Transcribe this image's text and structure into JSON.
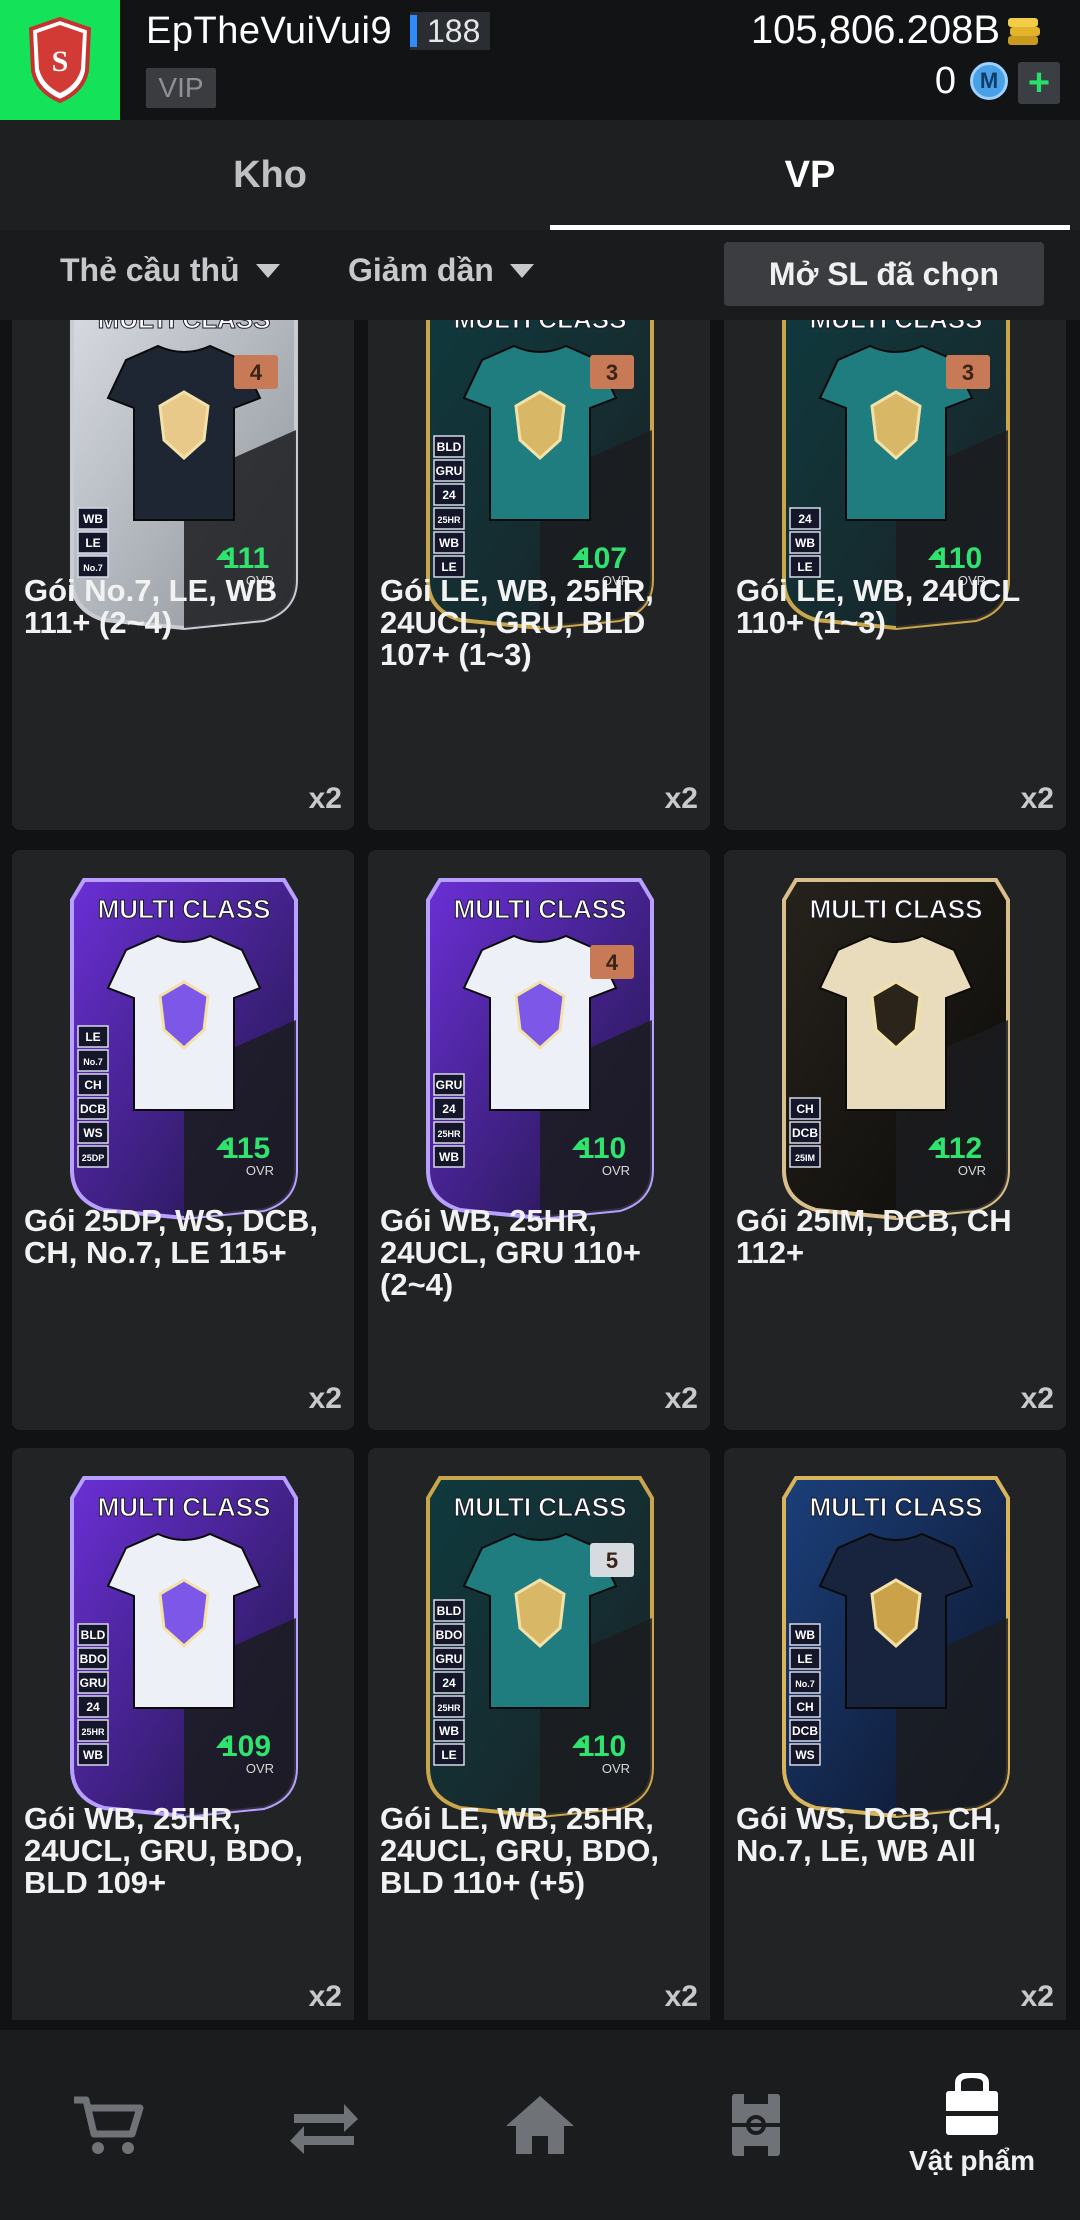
{
  "user": {
    "name": "EpTheVuiVui9",
    "level": "188",
    "vip": "VIP",
    "coins": "105,806.208B",
    "m_points": "0",
    "m_icon_label": "M",
    "plus": "+"
  },
  "tabs": [
    {
      "label": "Kho",
      "active": false
    },
    {
      "label": "VP",
      "active": true
    }
  ],
  "filters": {
    "type": "Thẻ cầu thủ",
    "sort": "Giảm dần",
    "open_selected": "Mở SL đã chọn"
  },
  "colors": {
    "accent_green": "#14e35a",
    "ovr_green": "#2fe36e",
    "level_blue": "#2f8cff"
  },
  "items": [
    {
      "title": "Gói No.7, LE, WB 111+ (2~4)",
      "qty": "x2",
      "ovr": "111",
      "ovr_label": "OVR",
      "header": "MULTI CLASS",
      "badge": "4",
      "tags": [
        "WB",
        "LE",
        "No.7"
      ],
      "theme": "silver"
    },
    {
      "title": "Gói LE, WB, 25HR,\n24UCL, GRU, BLD\n107+ (1~3)",
      "qty": "x2",
      "ovr": "107",
      "ovr_label": "OVR",
      "header": "MULTI CLASS",
      "badge": "3",
      "tags": [
        "BLD",
        "GRU",
        "24",
        "25HR",
        "WB",
        "LE"
      ],
      "theme": "teal"
    },
    {
      "title": "Gói LE, WB, 24UCL\n110+ (1~3)",
      "qty": "x2",
      "ovr": "110",
      "ovr_label": "OVR",
      "header": "MULTI CLASS",
      "badge": "3",
      "tags": [
        "24",
        "WB",
        "LE"
      ],
      "theme": "teal"
    },
    {
      "title": "Gói 25DP, WS, DCB,\nCH, No.7, LE 115+",
      "qty": "x2",
      "ovr": "115",
      "ovr_label": "OVR",
      "header": "MULTI CLASS",
      "badge": "",
      "tags": [
        "LE",
        "No.7",
        "CH",
        "DCB",
        "WS",
        "25DP"
      ],
      "theme": "purple"
    },
    {
      "title": "Gói WB, 25HR,\n24UCL, GRU 110+\n(2~4)",
      "qty": "x2",
      "ovr": "110",
      "ovr_label": "OVR",
      "header": "MULTI CLASS",
      "badge": "4",
      "tags": [
        "GRU",
        "24",
        "25HR",
        "WB"
      ],
      "theme": "purple"
    },
    {
      "title": "Gói 25IM, DCB, CH\n112+",
      "qty": "x2",
      "ovr": "112",
      "ovr_label": "OVR",
      "header": "MULTI CLASS",
      "badge": "",
      "tags": [
        "CH",
        "DCB",
        "25IM"
      ],
      "theme": "gold"
    },
    {
      "title": "Gói WB, 25HR,\n24UCL, GRU, BDO,\nBLD 109+",
      "qty": "x2",
      "ovr": "109",
      "ovr_label": "OVR",
      "header": "MULTI CLASS",
      "badge": "",
      "tags": [
        "BLD",
        "BDO",
        "GRU",
        "24",
        "25HR",
        "WB"
      ],
      "theme": "purple"
    },
    {
      "title": "Gói LE, WB, 25HR,\n24UCL, GRU, BDO,\nBLD 110+ (+5)",
      "qty": "x2",
      "ovr": "110",
      "ovr_label": "OVR",
      "header": "MULTI CLASS",
      "badge": "5",
      "tags": [
        "BLD",
        "BDO",
        "GRU",
        "24",
        "25HR",
        "WB",
        "LE"
      ],
      "theme": "teal"
    },
    {
      "title": "Gói WS, DCB, CH,\nNo.7, LE, WB All",
      "qty": "x2",
      "ovr": "",
      "ovr_label": "",
      "header": "MULTI CLASS",
      "badge": "",
      "tags": [
        "WB",
        "LE",
        "No.7",
        "CH",
        "DCB",
        "WS"
      ],
      "theme": "navy"
    }
  ],
  "nav": [
    {
      "icon": "cart-icon",
      "label": ""
    },
    {
      "icon": "transfer-icon",
      "label": ""
    },
    {
      "icon": "home-icon",
      "label": ""
    },
    {
      "icon": "pitch-icon",
      "label": ""
    },
    {
      "icon": "bag-icon",
      "label": "Vật phẩm"
    }
  ]
}
